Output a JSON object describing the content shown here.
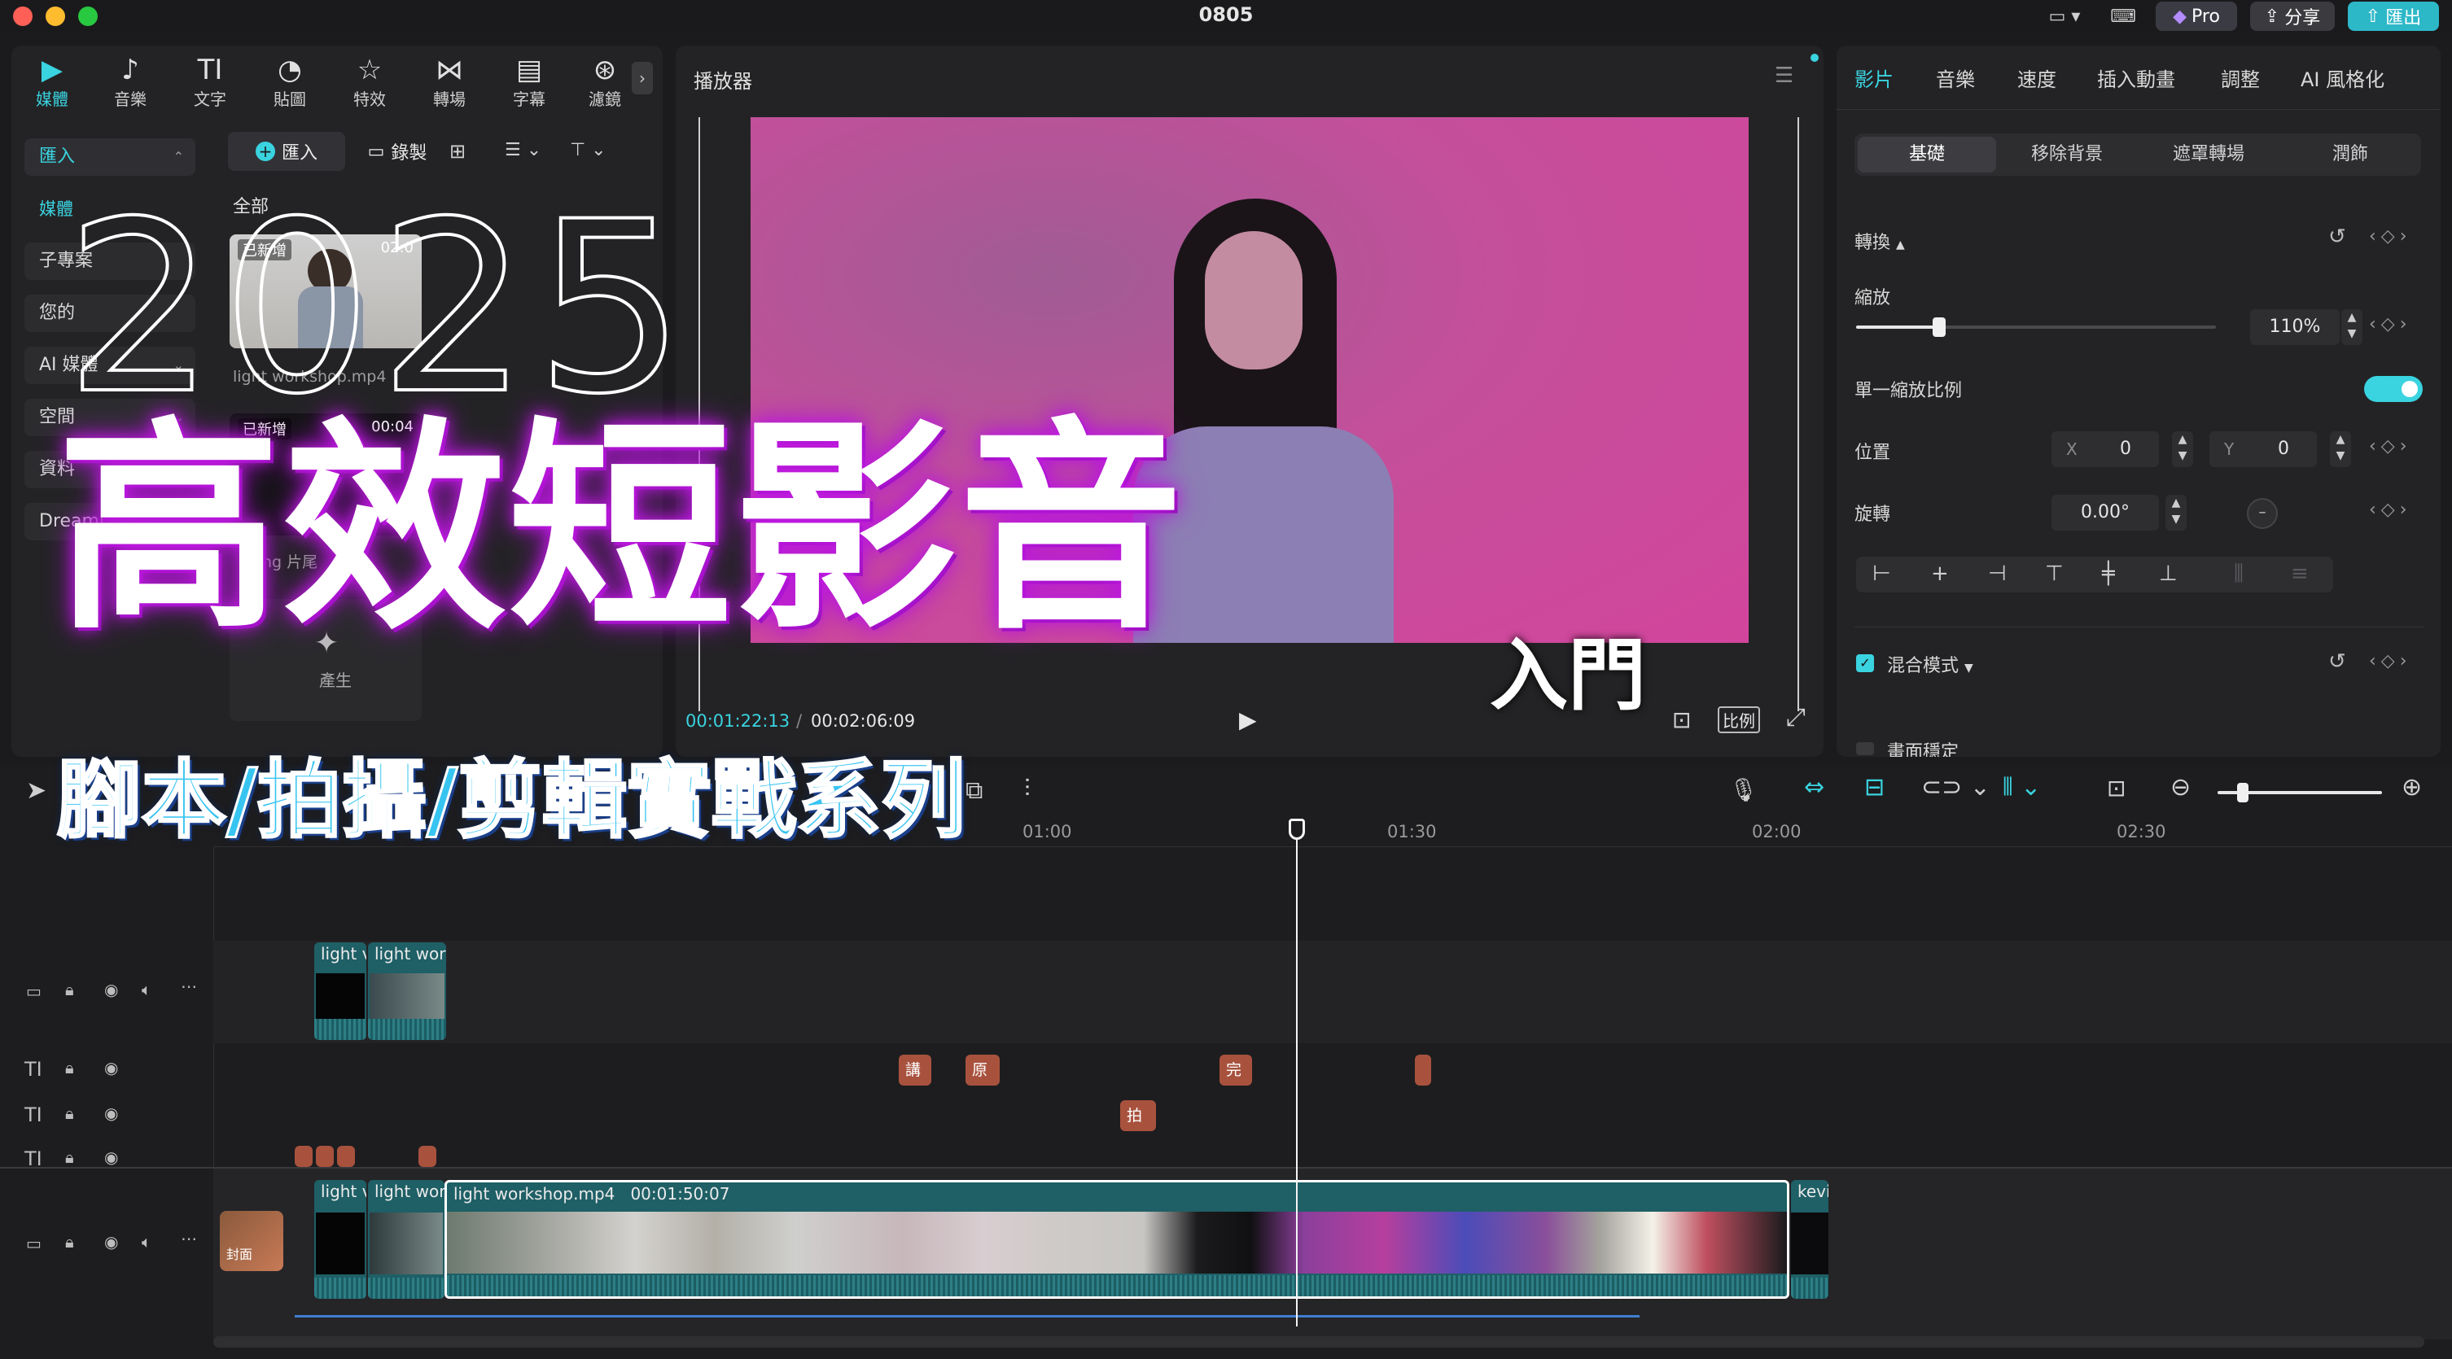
{
  "window": {
    "title": "0805",
    "pro_label": "Pro",
    "share_label": "分享",
    "export_label": "匯出"
  },
  "categories": [
    {
      "label": "媒體",
      "icon": "media-icon"
    },
    {
      "label": "音樂",
      "icon": "music-icon"
    },
    {
      "label": "文字",
      "icon": "text-icon"
    },
    {
      "label": "貼圖",
      "icon": "sticker-icon"
    },
    {
      "label": "特效",
      "icon": "effects-icon"
    },
    {
      "label": "轉場",
      "icon": "transition-icon"
    },
    {
      "label": "字幕",
      "icon": "caption-icon"
    },
    {
      "label": "濾鏡",
      "icon": "filter-icon"
    }
  ],
  "sidebar": {
    "items": [
      {
        "label": "匯入"
      },
      {
        "label": "媒體"
      },
      {
        "label": "子專案"
      },
      {
        "label": "您的"
      },
      {
        "label": "AI 媒體"
      },
      {
        "label": "空間"
      },
      {
        "label": "資料"
      },
      {
        "label": "Dreami"
      }
    ]
  },
  "media": {
    "import_label": "匯入",
    "record_label": "錄製",
    "all_label": "全部",
    "items": [
      {
        "badge": "已新增",
        "duration": "02:0",
        "name": "light workshop.mp4"
      },
      {
        "badge": "已新增",
        "duration": "00:04",
        "name": "ng 片尾"
      },
      {
        "name": "產生"
      }
    ]
  },
  "overlay": {
    "year": "2025",
    "headline": "高效短影音",
    "tag": "入門",
    "subtitle": "腳本/拍攝/剪輯實戰系列"
  },
  "player": {
    "title": "播放器",
    "current_time": "00:01:22:13",
    "total_time": "00:02:06:09",
    "ratio_label": "比例"
  },
  "properties": {
    "tabs": [
      "影片",
      "音樂",
      "速度",
      "插入動畫",
      "調整",
      "AI 風格化"
    ],
    "subtabs": [
      "基礎",
      "移除背景",
      "遮罩轉場",
      "潤飾"
    ],
    "transform_label": "轉換",
    "scale_label": "縮放",
    "scale_value": "110%",
    "scale_slider_fraction": 0.23,
    "uniform_scale_label": "單一縮放比例",
    "position_label": "位置",
    "pos_x_label": "X",
    "pos_x": "0",
    "pos_y_label": "Y",
    "pos_y": "0",
    "rotation_label": "旋轉",
    "rotation_value": "0.00°",
    "blend_label": "混合模式",
    "stabilize_label": "畫面穩定"
  },
  "timeline": {
    "ruler": [
      "01:00",
      "01:30",
      "02:00",
      "02:30"
    ],
    "main_clip_label": "light workshop.mp4",
    "main_clip_duration": "00:01:50:07",
    "short_clip_1": "light v",
    "short_clip_2": "light wor",
    "tail_clip": "kevi",
    "cover_label": "封面",
    "text_clips": [
      "講",
      "原來",
      "完整",
      "拍下"
    ]
  },
  "colors": {
    "accent": "#3ad3e0",
    "headline_glow": "#c01be0",
    "subtitle": "#38c4f1",
    "clip_teal": "#1f5f66",
    "text_clip": "#a8523e"
  }
}
